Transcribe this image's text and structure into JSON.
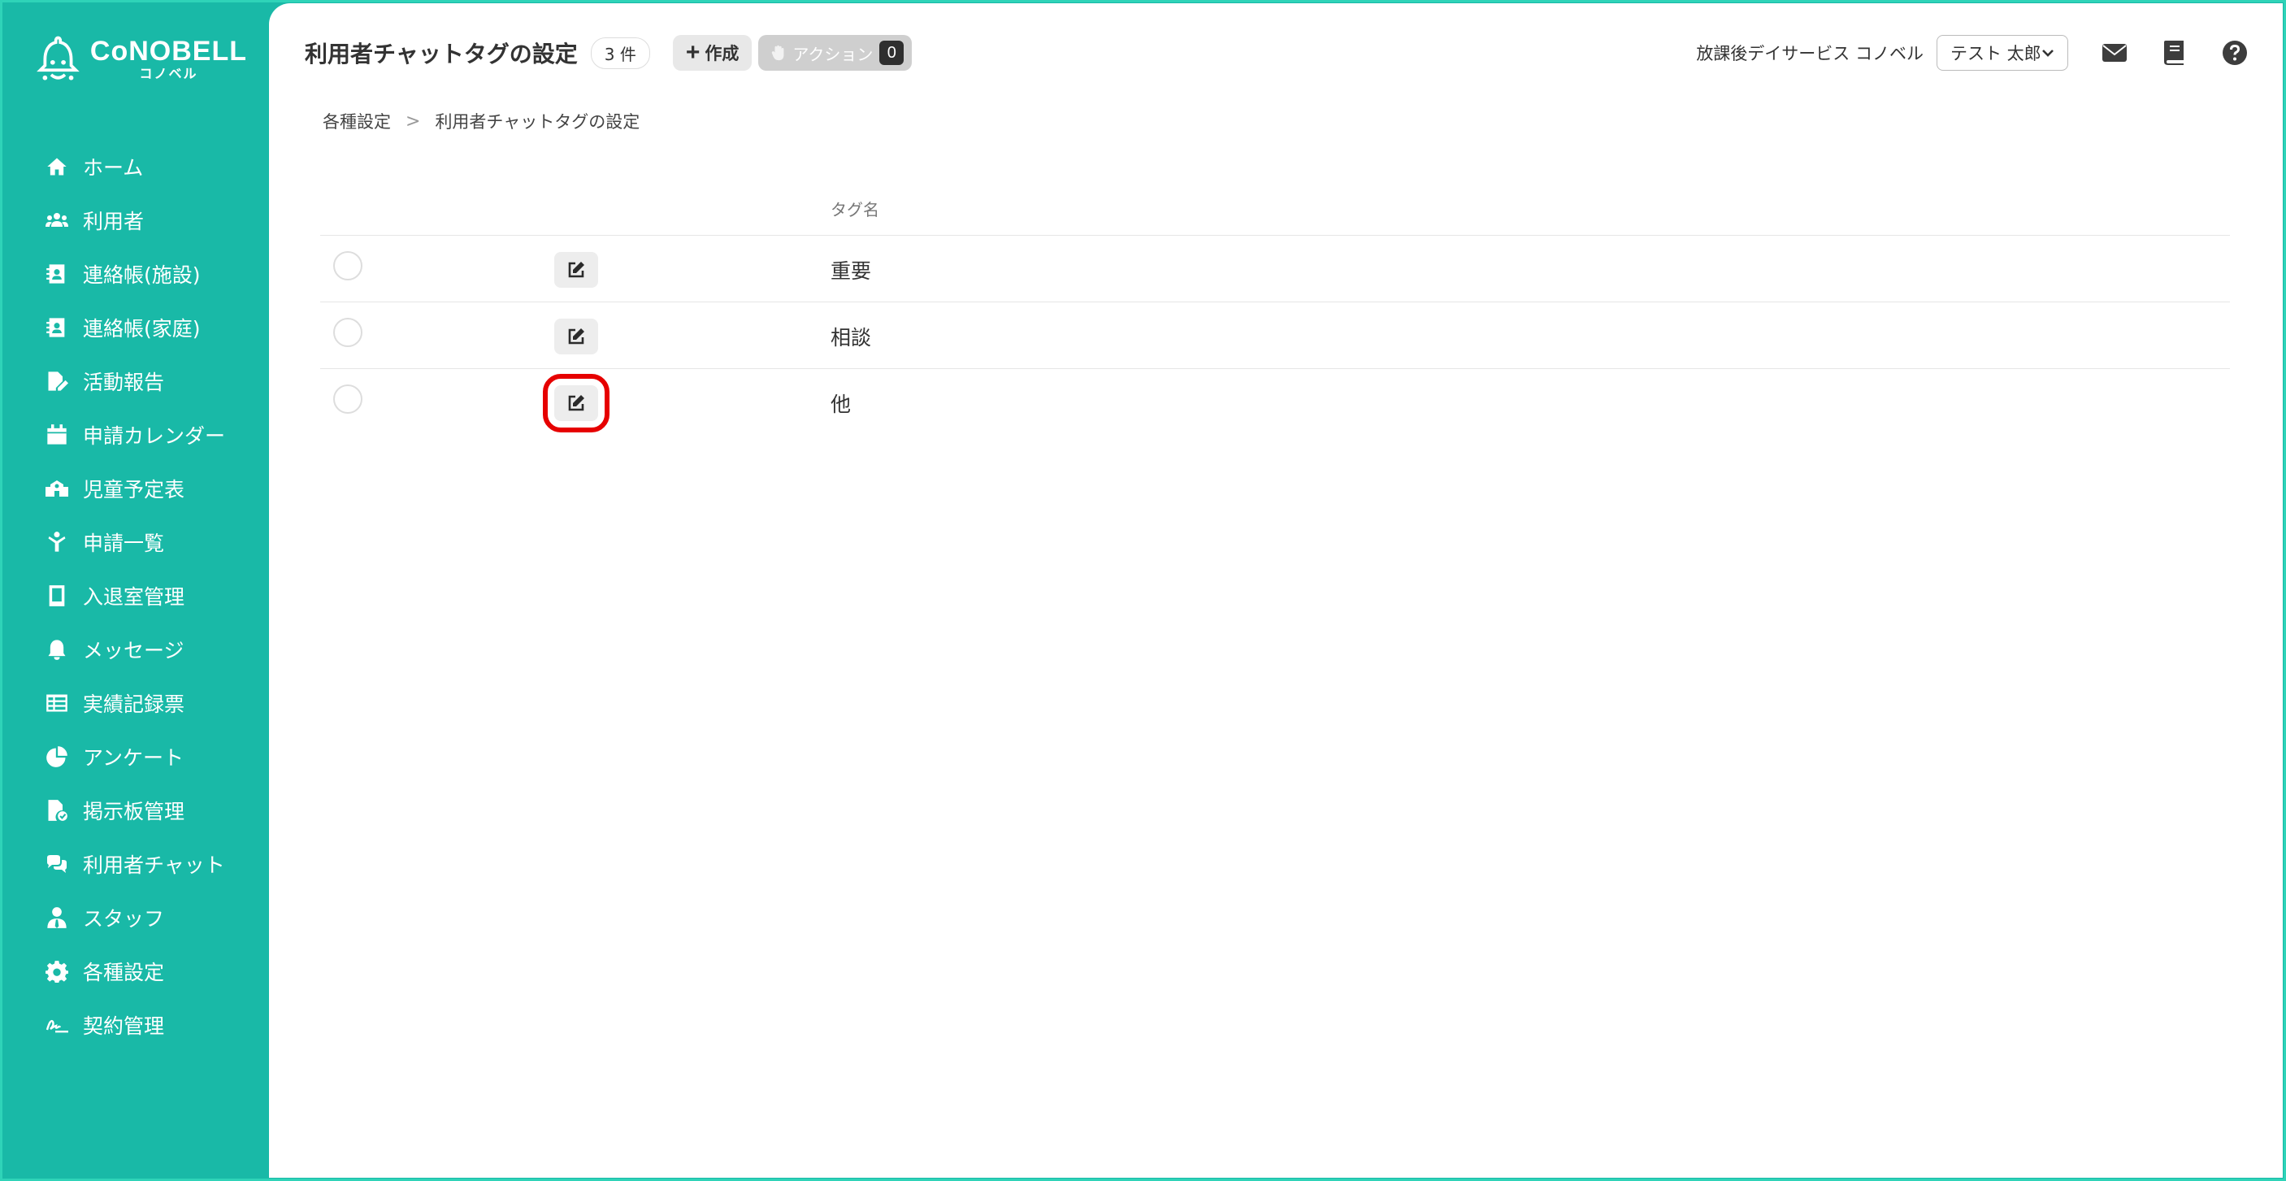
{
  "logo": {
    "main": "CoNOBELL",
    "sub": "コノベル"
  },
  "sidebar": {
    "items": [
      {
        "label": "ホーム",
        "icon": "home-icon"
      },
      {
        "label": "利用者",
        "icon": "users-icon"
      },
      {
        "label": "連絡帳(施設)",
        "icon": "contact-book-icon"
      },
      {
        "label": "連絡帳(家庭)",
        "icon": "contact-book-icon"
      },
      {
        "label": "活動報告",
        "icon": "file-edit-icon"
      },
      {
        "label": "申請カレンダー",
        "icon": "calendar-icon"
      },
      {
        "label": "児童予定表",
        "icon": "school-icon"
      },
      {
        "label": "申請一覧",
        "icon": "child-icon"
      },
      {
        "label": "入退室管理",
        "icon": "tablet-icon"
      },
      {
        "label": "メッセージ",
        "icon": "bell-icon"
      },
      {
        "label": "実績記録票",
        "icon": "table-icon"
      },
      {
        "label": "アンケート",
        "icon": "pie-chart-icon"
      },
      {
        "label": "掲示板管理",
        "icon": "file-check-icon"
      },
      {
        "label": "利用者チャット",
        "icon": "chat-icon"
      },
      {
        "label": "スタッフ",
        "icon": "staff-icon"
      },
      {
        "label": "各種設定",
        "icon": "gear-icon"
      },
      {
        "label": "契約管理",
        "icon": "signature-icon"
      }
    ]
  },
  "header": {
    "title": "利用者チャットタグの設定",
    "count": "3 件",
    "create_label": "作成",
    "action_label": "アクション",
    "action_count": "0",
    "facility": "放課後デイサービス コノベル",
    "user": "テスト 太郎"
  },
  "breadcrumb": {
    "parent": "各種設定",
    "current": "利用者チャットタグの設定"
  },
  "table": {
    "column_name": "タグ名",
    "rows": [
      {
        "name": "重要"
      },
      {
        "name": "相談"
      },
      {
        "name": "他"
      }
    ]
  },
  "colors": {
    "sidebar_bg": "#19b9a7",
    "highlight": "#e60000"
  }
}
